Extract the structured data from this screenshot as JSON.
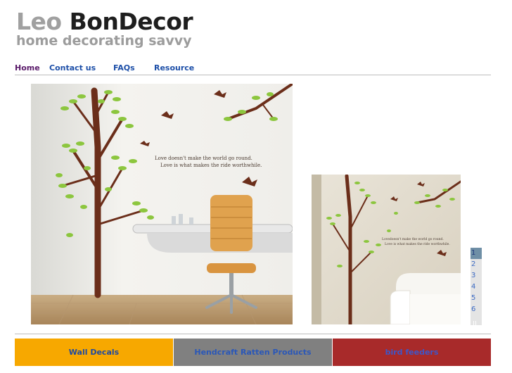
{
  "site": {
    "logo_first": "Leo",
    "logo_second": "BonDecor",
    "tagline": "home decorating savvy"
  },
  "nav": {
    "items": [
      {
        "label": "Home",
        "active": true
      },
      {
        "label": "Contact us",
        "active": false
      },
      {
        "label": "FAQs",
        "active": false
      },
      {
        "label": "Resource",
        "active": false
      }
    ]
  },
  "hero": {
    "quote_line1": "Love doesn't make the world go round.",
    "quote_line2": "Love is what makes the ride worthwhile."
  },
  "side_image": {
    "quote_line1": "Lovedoesn't make the world go round.",
    "quote_line2": "Love is what makes the ride worthwhile."
  },
  "slider": {
    "pages": [
      "1",
      "2",
      "3",
      "4",
      "5",
      "6"
    ],
    "selected": "1",
    "pause": "II"
  },
  "categories": [
    {
      "label": "Wall Decals",
      "color": "#f7a800"
    },
    {
      "label": "Hendcraft Ratten Products",
      "color": "#808080"
    },
    {
      "label": "bird feeders",
      "color": "#a82a2a"
    }
  ],
  "colors": {
    "leaf_green": "#8cc63e",
    "trunk_brown": "#6b2e1a",
    "nav_link": "#1d4fa8",
    "nav_active": "#5a1a6a"
  }
}
